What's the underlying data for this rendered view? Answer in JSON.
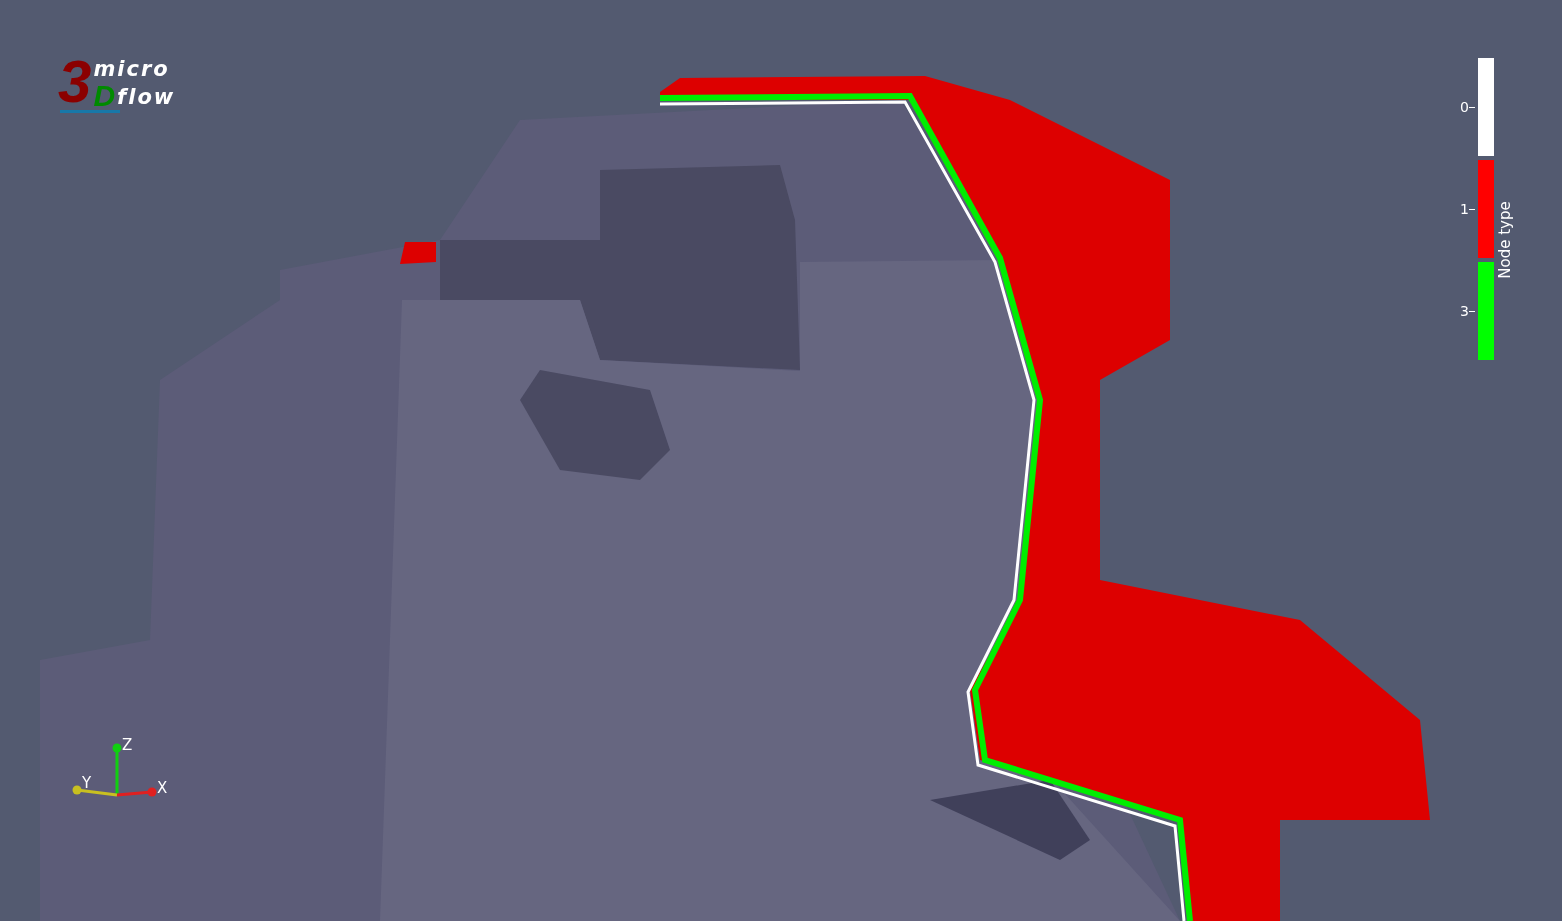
{
  "logo": {
    "digit": "3",
    "letter": "D",
    "top": "micro",
    "bottom": "flow"
  },
  "legend": {
    "title": "Node type",
    "entries": [
      {
        "label": "0",
        "color": "#ffffff"
      },
      {
        "label": "1",
        "color": "#ff0000"
      },
      {
        "label": "3",
        "color": "#00ff00"
      }
    ]
  },
  "axes": [
    {
      "label": "Z",
      "color": "#10d010"
    },
    {
      "label": "Y",
      "color": "#c8c020"
    },
    {
      "label": "X",
      "color": "#e02020"
    }
  ]
}
